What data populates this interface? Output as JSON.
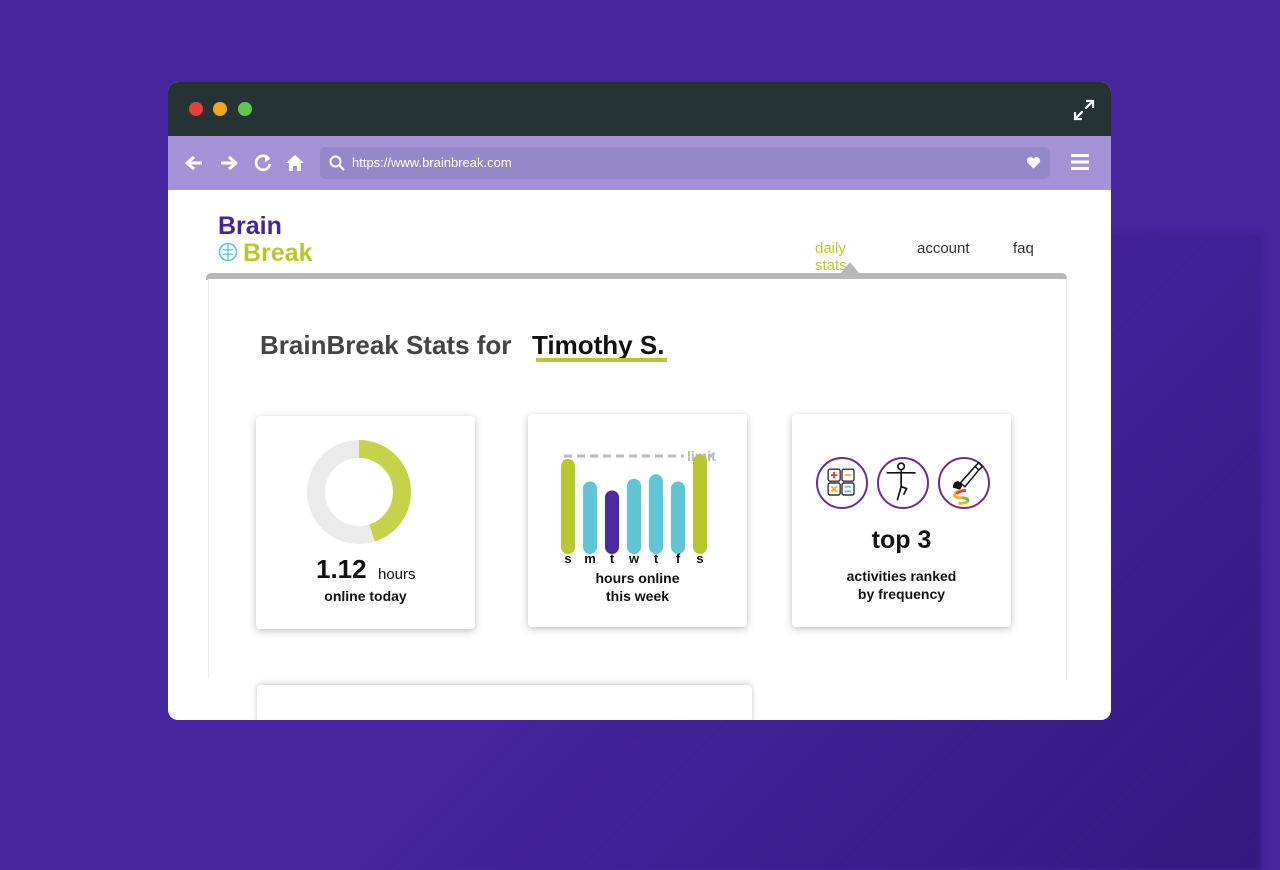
{
  "browser": {
    "url": "https://www.brainbreak.com"
  },
  "logo": {
    "line1": "Brain",
    "line2": "Break"
  },
  "nav": {
    "items": [
      {
        "label": "daily stats",
        "active": true
      },
      {
        "label": "account"
      },
      {
        "label": "faq"
      }
    ]
  },
  "page": {
    "title_prefix": "BrainBreak Stats for",
    "user_name": "Timothy S."
  },
  "cards": {
    "today": {
      "value": "1.12",
      "unit": "hours",
      "caption": "online today",
      "progress_fraction": 0.45
    },
    "week": {
      "limit_label": "limit",
      "days": [
        "s",
        "m",
        "t",
        "w",
        "t",
        "f",
        "s"
      ],
      "caption_line1": "hours online",
      "caption_line2": "this week",
      "relative_usage": [
        0.9,
        0.65,
        0.55,
        0.68,
        0.73,
        0.65,
        0.95
      ],
      "highlight_day_index": 2
    },
    "activities": {
      "icons": [
        "calculator-icon",
        "yoga-icon",
        "paint-icon"
      ],
      "headline": "top 3",
      "caption_line1": "activities ranked",
      "caption_line2": "by frequency"
    }
  },
  "colors": {
    "background": "#46259f",
    "brand_purple": "#45259e",
    "brand_green": "#b8c72c",
    "bar_teal": "#5ec6d4",
    "bar_purple": "#4a2aa0",
    "toolbar": "#a392d6"
  }
}
